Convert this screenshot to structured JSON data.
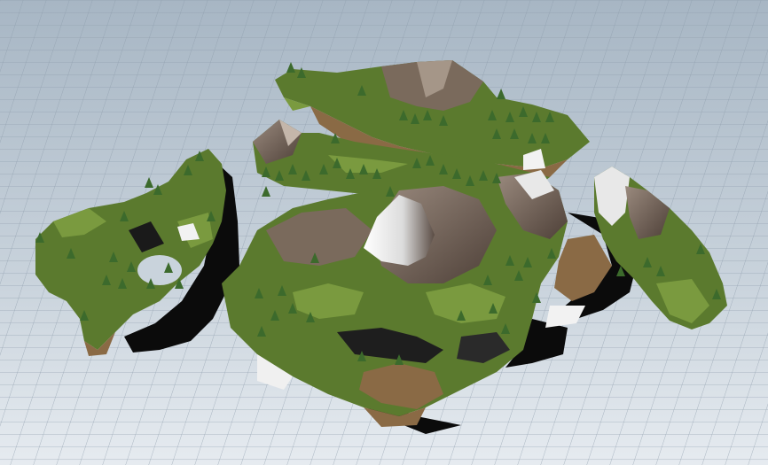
{
  "scene": {
    "type": "3d-viewport",
    "background": "grid-floor",
    "colors": {
      "sky_top": "#9fb0bf",
      "sky_bottom": "#e4eaf0",
      "grid_line": "#8a9aaa",
      "grass_dark": "#3f5a22",
      "grass": "#5b7a2e",
      "grass_light": "#7a9a3f",
      "dirt": "#8a6a45",
      "rock": "#6e5e52",
      "rock_light": "#a89a8e",
      "snow": "#f2f2f2",
      "shadow": "#0c0c0c",
      "tree": "#3c6a2c"
    },
    "objects": [
      "left-island",
      "back-island",
      "middle-island",
      "main-island",
      "right-island",
      "snow-peak"
    ]
  }
}
